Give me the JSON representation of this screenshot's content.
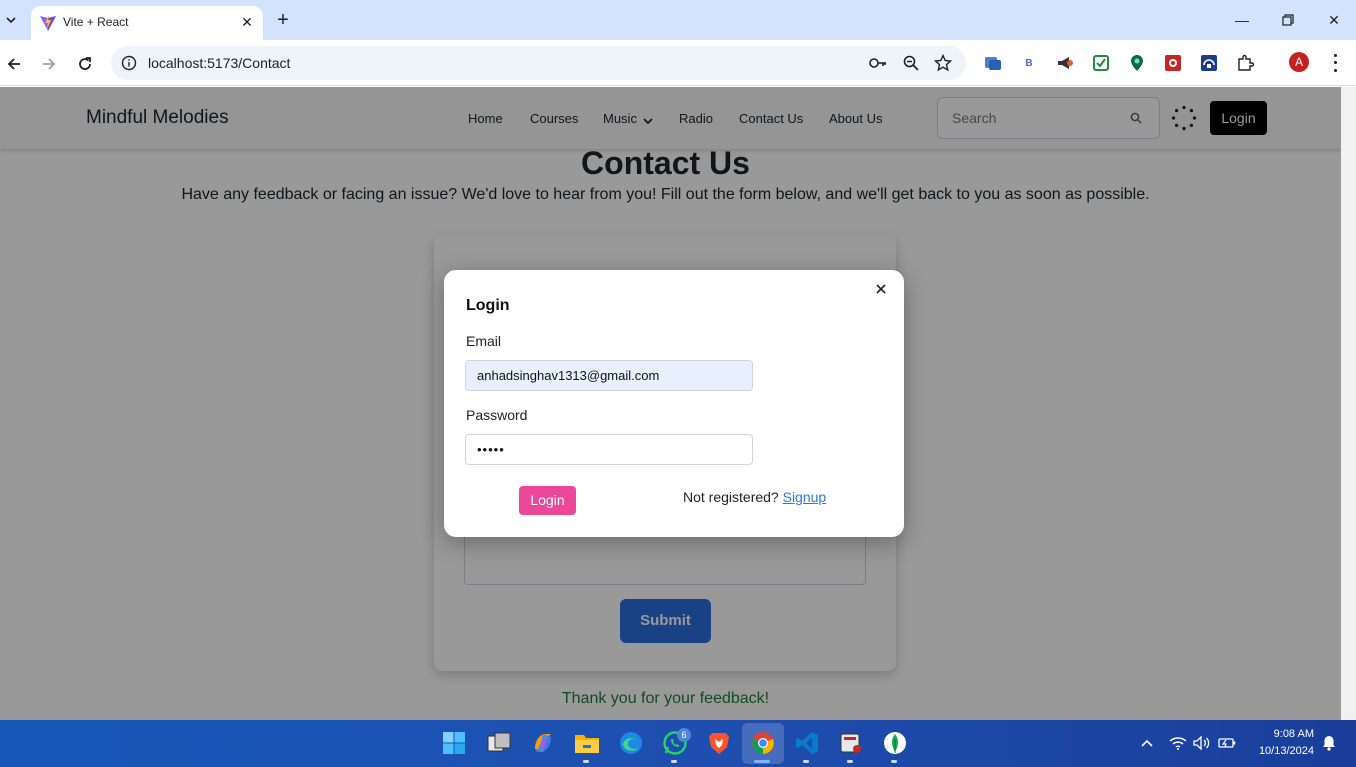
{
  "browser": {
    "tab_title": "Vite + React",
    "url": "localhost:5173/Contact",
    "profile_initial": "A",
    "extensions": [
      "meet-extension-icon",
      "b-extension-icon",
      "megaphone-extension-icon",
      "checklist-extension-icon",
      "pin-extension-icon",
      "red-extension-icon",
      "drive-extension-icon",
      "puzzle-extensions-icon"
    ],
    "ext_b_label": "B"
  },
  "site": {
    "brand": "Mindful Melodies",
    "nav": [
      "Home",
      "Courses",
      "Music",
      "Radio",
      "Contact Us",
      "About Us"
    ],
    "search_placeholder": "Search",
    "login_label": "Login"
  },
  "contact": {
    "title": "Contact Us",
    "subtitle": "Have any feedback or facing an issue? We'd love to hear from you! Fill out the form below, and we'll get back to you as soon as possible.",
    "submit_label": "Submit",
    "thanks": "Thank you for your feedback!"
  },
  "modal": {
    "title": "Login",
    "email_label": "Email",
    "email_value": "anhadsinghav1313@gmail.com",
    "password_label": "Password",
    "password_value": "•••••",
    "login_label": "Login",
    "not_registered": "Not registered?",
    "signup_label": "Signup"
  },
  "taskbar": {
    "whatsapp_badge": "6",
    "time": "9:08 AM",
    "date": "10/13/2024"
  },
  "colors": {
    "accent_pink": "#ec4899",
    "submit_blue": "#2b6dde",
    "thanks_green": "#1e7c3a",
    "chrome_blue": "#d3e3fd"
  }
}
